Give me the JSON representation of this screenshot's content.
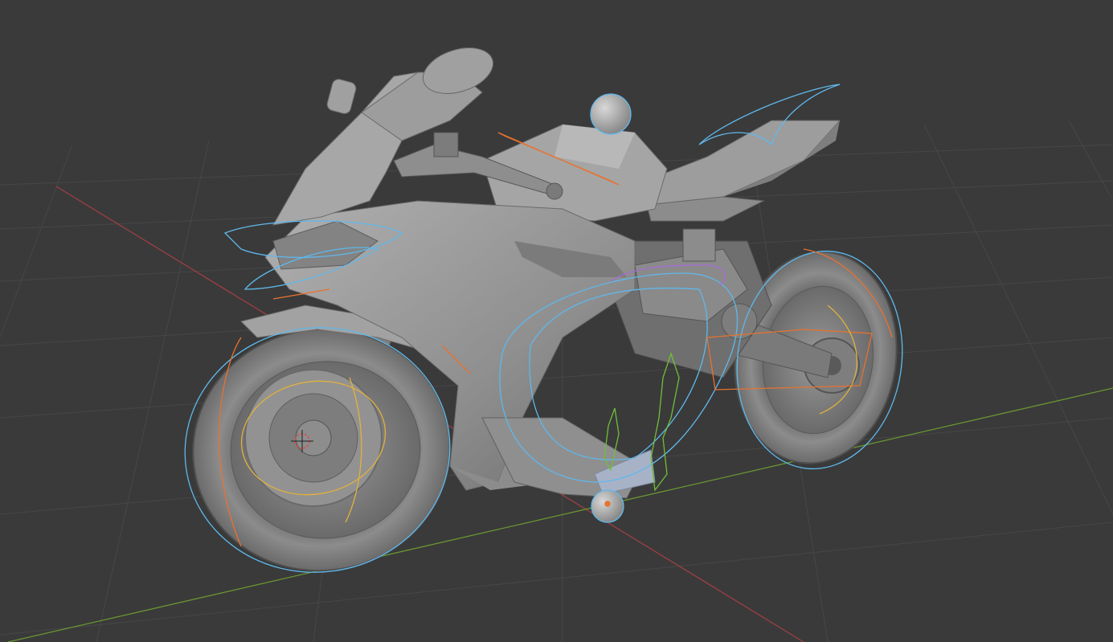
{
  "viewport": {
    "kind": "3d-viewport",
    "shading": "solid",
    "overlays": [
      "floor-grid",
      "x-axis-line",
      "y-axis-line",
      "rig-controls",
      "3d-cursor"
    ],
    "subject": "motorcycle-model"
  },
  "colors": {
    "background": "#3a3a3a",
    "grid": "#474747",
    "x_axis": "#9e3f45",
    "y_axis": "#6a9632",
    "model_light": "#a9a9a9",
    "model_mid": "#8a8a8a",
    "model_dark": "#5e5e5e",
    "control_blue": "#5fb8ec",
    "control_orange": "#e8722f",
    "control_yellow": "#e2b13c",
    "control_green": "#6fbf3a",
    "control_purple": "#a86ad6",
    "cursor": "#d94b4b"
  },
  "icons": {
    "cursor": "3d-cursor-icon"
  }
}
